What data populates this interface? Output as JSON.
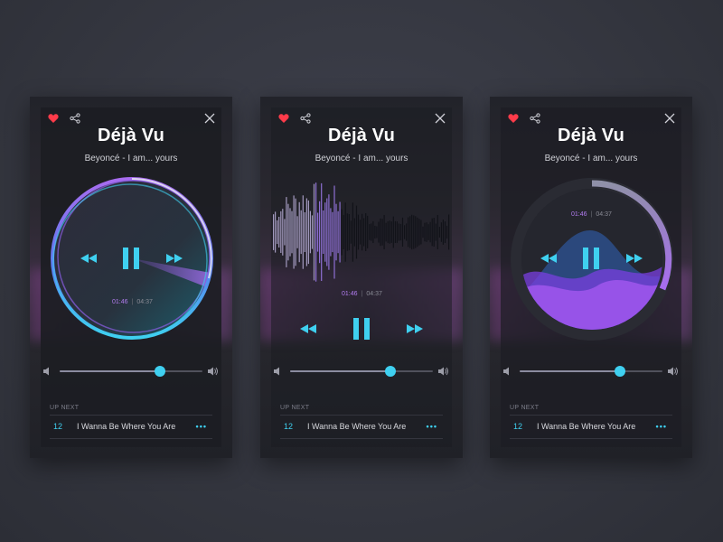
{
  "track": {
    "title": "Déjà Vu",
    "subtitle": "Beyoncé - I am... yours",
    "current_time": "01:46",
    "separator": "|",
    "duration": "04:37",
    "progress": 0.38,
    "volume": 0.7
  },
  "up_next": {
    "header": "UP NEXT",
    "number": "12",
    "song": "I Wanna Be Where You Are",
    "more": "•••"
  },
  "colors": {
    "accent": "#3fd0f0",
    "purple": "#a86cf0",
    "heart": "#ff3b4a",
    "background": "#363841"
  },
  "icons": [
    "heart-icon",
    "share-icon",
    "close-icon",
    "rewind-icon",
    "pause-icon",
    "fast-forward-icon",
    "volume-low-icon",
    "volume-high-icon",
    "more-icon"
  ]
}
